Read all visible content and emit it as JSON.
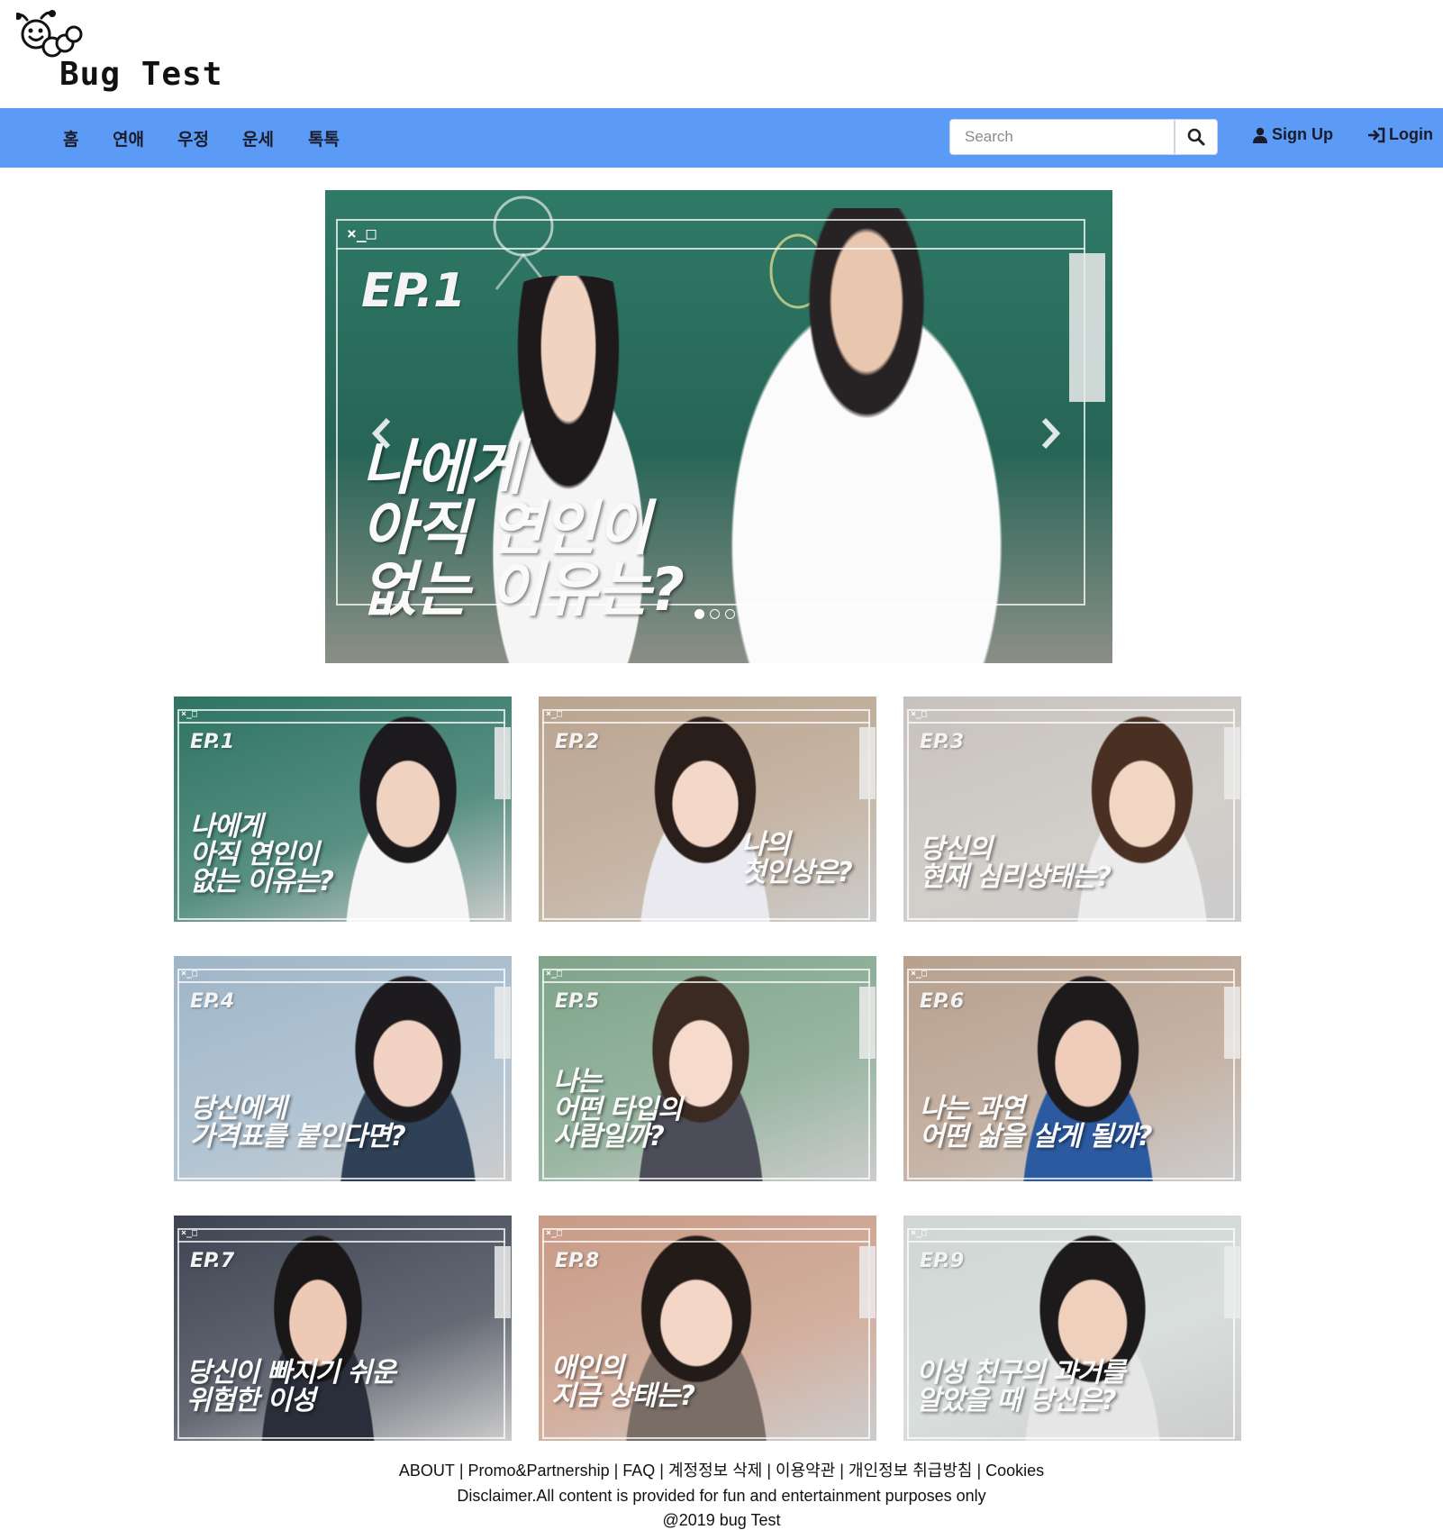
{
  "brand": {
    "name": "Bug Test",
    "logo_icon": "bug-mascot-icon"
  },
  "nav": {
    "items": [
      "홈",
      "연애",
      "우정",
      "운세",
      "톡톡"
    ],
    "search_placeholder": "Search",
    "search_icon": "search-icon",
    "signup_label": "Sign Up",
    "signup_icon": "user-icon",
    "login_label": "Login",
    "login_icon": "login-icon",
    "bar_color": "#5b9bf5"
  },
  "carousel": {
    "ep": "EP.1",
    "headline": "나에게\n아직 연인이\n없는 이유는?",
    "prev_icon": "chevron-left-icon",
    "next_icon": "chevron-right-icon",
    "slide_count": 3,
    "active_slide": 1
  },
  "cards": [
    {
      "ep": "EP.1",
      "headline": "나에게\n아직 연인이\n없는 이유는?",
      "bg": "#2e7463"
    },
    {
      "ep": "EP.2",
      "headline": "나의\n첫인상은?",
      "bg": "#b9a48f"
    },
    {
      "ep": "EP.3",
      "headline": "당신의\n현재 심리상태는?",
      "bg": "#c7c2bd"
    },
    {
      "ep": "EP.4",
      "headline": "당신에게\n가격표를 붙인다면?",
      "bg": "#9fb6c8"
    },
    {
      "ep": "EP.5",
      "headline": "나는\n어떤 타입의\n사람일까?",
      "bg": "#7fa48a"
    },
    {
      "ep": "EP.6",
      "headline": "나는 과연\n어떤 삶을 살게 될까?",
      "bg": "#b7a08e"
    },
    {
      "ep": "EP.7",
      "headline": "당신이 빠지기 쉬운\n위험한 이성",
      "bg": "#3e4452"
    },
    {
      "ep": "EP.8",
      "headline": "애인의\n지금 상태는?",
      "bg": "#c89b86"
    },
    {
      "ep": "EP.9",
      "headline": "이성 친구의 과거를\n알았을 때 당신은?",
      "bg": "#cfd6d4"
    }
  ],
  "footer": {
    "links": [
      "ABOUT",
      "Promo&Partnership",
      "FAQ",
      "계정정보 삭제",
      "이용약관",
      "개인정보 취급방침",
      "Cookies"
    ],
    "disclaimer": "Disclaimer.All content is provided for fun and entertainment purposes only",
    "copyright": "@2019 bug Test"
  }
}
